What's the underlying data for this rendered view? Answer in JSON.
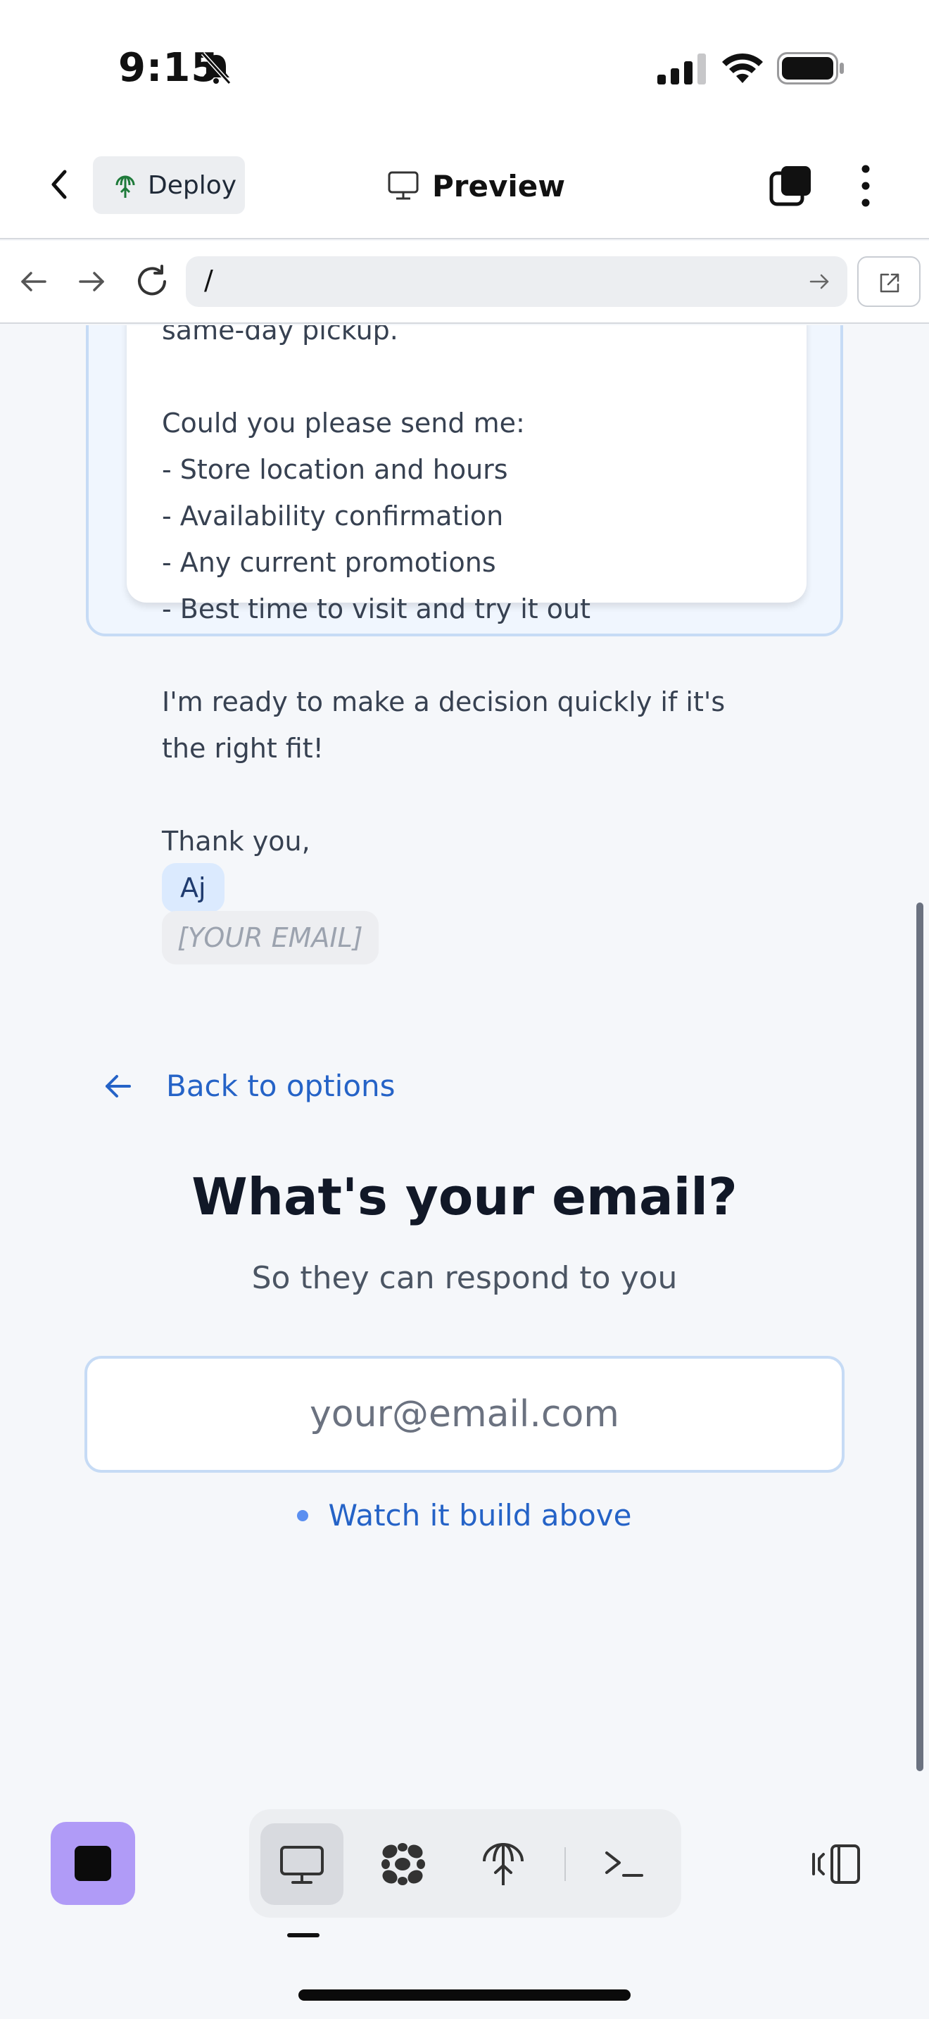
{
  "status_bar": {
    "time": "9:15"
  },
  "header": {
    "deploy_label": "Deploy",
    "preview_label": "Preview"
  },
  "browser": {
    "url": "/"
  },
  "email_preview": {
    "lines": [
      "same-day pickup.",
      "",
      "Could you please send me:",
      "- Store location and hours",
      "- Availability confirmation",
      "- Any current promotions",
      "- Best time to visit and try it out",
      "",
      "I'm ready to make a decision quickly if it's",
      "the right fit!",
      "",
      "Thank you,"
    ],
    "name_chip": "Aj",
    "email_chip": "[YOUR EMAIL]"
  },
  "form": {
    "back_label": "Back to options",
    "title": "What's your email?",
    "subtitle": "So they can respond to you",
    "email_placeholder": "your@email.com",
    "email_value": "",
    "hint": "Watch it build above"
  },
  "colors": {
    "accent": "#2563c7",
    "stop_button": "#b09bf7",
    "chip_name_bg": "#dbeafe",
    "card_border": "#c6dbf5"
  },
  "toolbar": {
    "icons": [
      "desktop-icon",
      "apps-icon",
      "deploy-icon",
      "terminal-icon",
      "panel-toggle-icon"
    ]
  }
}
